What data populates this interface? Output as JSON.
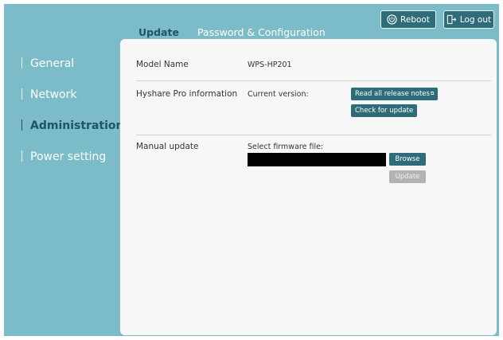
{
  "header": {
    "reboot_label": "Reboot",
    "logout_label": "Log out"
  },
  "tabs": [
    {
      "label": "Update",
      "active": true
    },
    {
      "label": "Password & Configuration",
      "active": false
    }
  ],
  "sidebar": {
    "items": [
      {
        "label": "General",
        "active": false
      },
      {
        "label": "Network",
        "active": false
      },
      {
        "label": "Administration",
        "active": true
      },
      {
        "label": "Power setting",
        "active": false
      }
    ]
  },
  "main": {
    "model": {
      "label": "Model Name",
      "value": "WPS-HP201"
    },
    "info": {
      "label": "Hyshare Pro information",
      "current_version_label": "Current version:",
      "release_notes_button": "Read all release notes",
      "check_update_button": "Check for update"
    },
    "manual": {
      "label": "Manual update",
      "select_file_label": "Select firmware file:",
      "file_value": "",
      "browse_button": "Browse",
      "update_button": "Update"
    }
  },
  "colors": {
    "background": "#7bbcc8",
    "accent": "#2e6c79",
    "active_text": "#1d5563",
    "panel": "#f7f7f7",
    "disabled": "#b3b3b3"
  }
}
